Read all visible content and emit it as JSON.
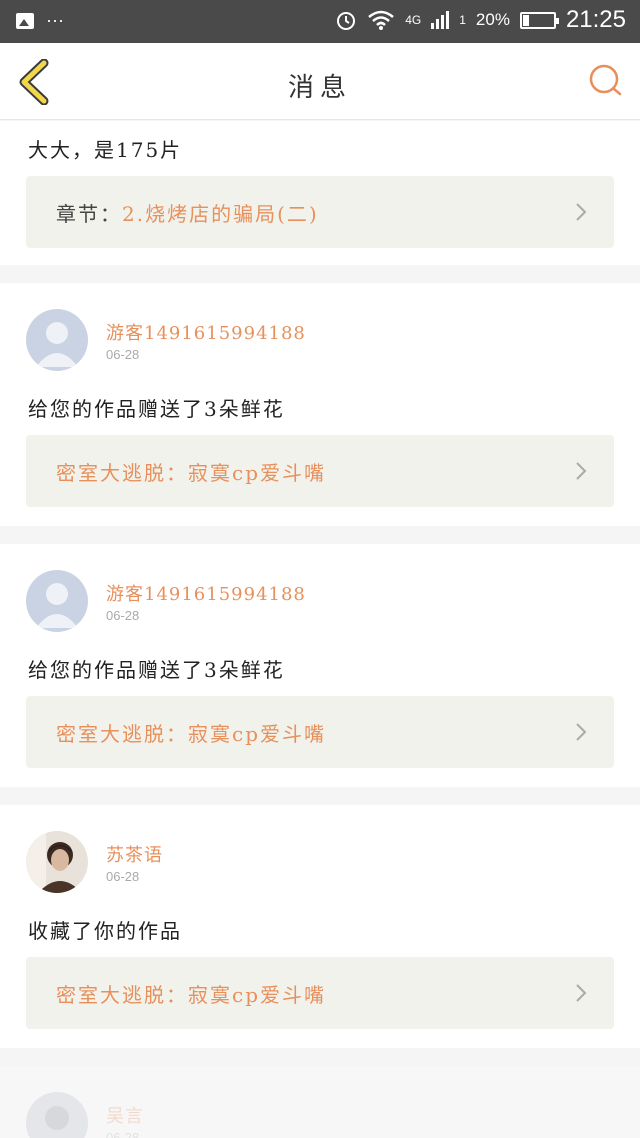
{
  "status_bar": {
    "dots": "···",
    "network": "4G",
    "signal_sub": "1",
    "battery_percent": "20%",
    "battery_level": 0.2,
    "time": "21:25"
  },
  "header": {
    "title": "消息"
  },
  "messages": [
    {
      "text": "大大，是175片",
      "link_prefix": "章节：",
      "link_label": "2.烧烤店的骗局(二)"
    },
    {
      "user": "游客1491615994188",
      "date": "06-28",
      "avatar": "default-avatar",
      "text": "给您的作品赠送了3朵鲜花",
      "link_label": "密室大逃脱：寂寞cp爱斗嘴"
    },
    {
      "user": "游客1491615994188",
      "date": "06-28",
      "avatar": "default-avatar",
      "text": "给您的作品赠送了3朵鲜花",
      "link_label": "密室大逃脱：寂寞cp爱斗嘴"
    },
    {
      "user": "苏茶语",
      "date": "06-28",
      "avatar": "photo-avatar",
      "text": "收藏了你的作品",
      "link_label": "密室大逃脱：寂寞cp爱斗嘴"
    },
    {
      "user": "吴言",
      "date": "06-28",
      "avatar": "photo-avatar"
    }
  ],
  "colors": {
    "accent": "#e8905c",
    "back_arrow": "#f0d84a",
    "status_bar_bg": "#4a4a4a",
    "link_box_bg": "#f2f2ec"
  }
}
